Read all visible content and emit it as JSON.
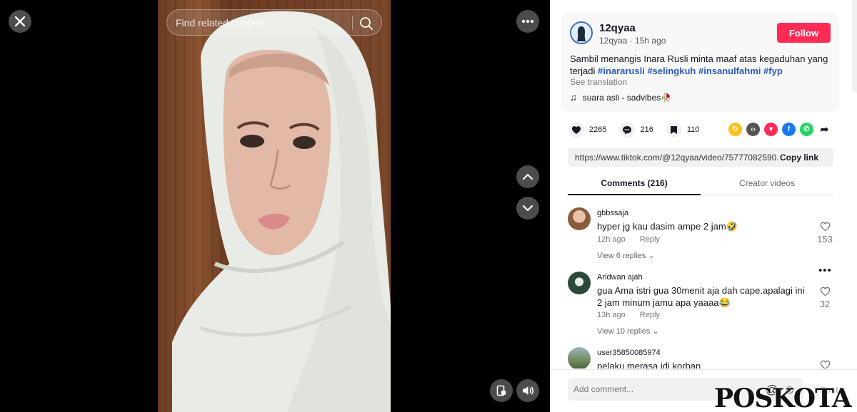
{
  "video": {
    "search_placeholder": "Find related content"
  },
  "post": {
    "username": "12qyaa",
    "handle": "12qyaa",
    "time_ago": "15h ago",
    "follow_label": "Follow",
    "description": "Sambil menangis Inara Rusli minta maaf atas kegaduhan yang terjadi",
    "hashtags": [
      "#inararusli",
      "#selingkuh",
      "#insanulfahmi",
      "#fyp"
    ],
    "see_translation": "See translation",
    "music": "suara asli - sadvibes🥀"
  },
  "actions": {
    "likes": "2265",
    "comments": "216",
    "saves": "110"
  },
  "link": {
    "url": "https://www.tiktok.com/@12qyaa/video/75777082590...",
    "copy_label": "Copy link"
  },
  "tabs": {
    "comments": "Comments (216)",
    "creator_videos": "Creator videos"
  },
  "comments": [
    {
      "user": "gbbssaja",
      "text": "hyper jg kau dasim ampe 2 jam🤣",
      "time": "12h ago",
      "reply": "Reply",
      "replies": "View 6 replies",
      "likes": "153"
    },
    {
      "user": "Aridwan ajah",
      "text": "gua Ama istri gua 30menit aja dah cape.apalagi ini 2 jam minum jamu apa yaaaa😂",
      "time": "13h ago",
      "reply": "Reply",
      "replies": "View 10 replies",
      "likes": "32"
    },
    {
      "user": "user35850085974",
      "text": "pelaku merasa jdi korban",
      "time": "",
      "reply": "",
      "replies": "",
      "likes": ""
    }
  ],
  "footer": {
    "input_placeholder": "Add comment...",
    "post_label": "Post"
  },
  "watermark": "POSKOTA",
  "colors": {
    "follow": "#fe2c55",
    "hashtag": "#2b5db9"
  }
}
